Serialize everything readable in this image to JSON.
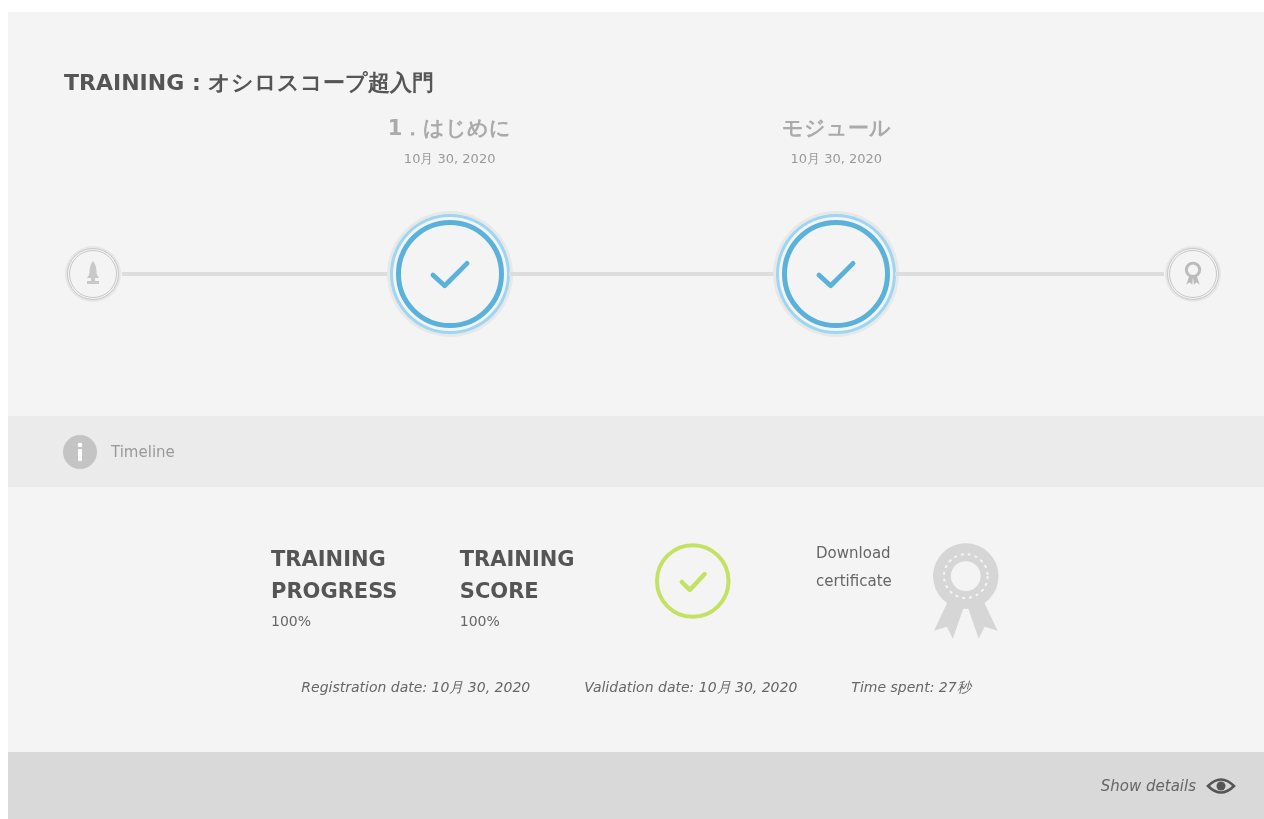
{
  "title": "TRAINING : オシロスコープ超入門",
  "timeline": [
    {
      "kind": "start"
    },
    {
      "kind": "step",
      "label": "1．はじめに",
      "date": "10月 30, 2020",
      "completed": true
    },
    {
      "kind": "step",
      "label": "モジュール",
      "date": "10月 30, 2020",
      "completed": true
    },
    {
      "kind": "end"
    }
  ],
  "timeline_bar": {
    "label": "Timeline"
  },
  "stats": [
    {
      "label": "TRAINING PROGRESS",
      "value": "100%"
    },
    {
      "label": "TRAINING SCORE",
      "value": "100%"
    }
  ],
  "validated": true,
  "certificate": {
    "label": "Download certificate"
  },
  "dates": [
    "Registration date: 10月 30, 2020",
    "Validation date: 10月 30, 2020",
    "Time spent: 27秒"
  ],
  "footer": {
    "link": "Show details"
  }
}
